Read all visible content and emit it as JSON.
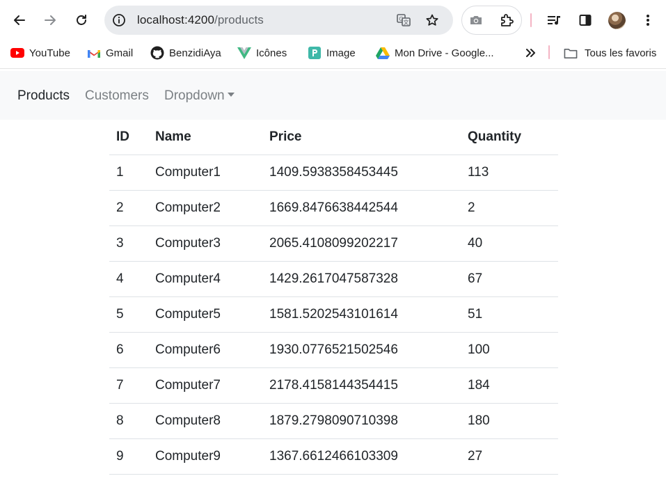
{
  "browser": {
    "url_host": "localhost:4200",
    "url_path": "/products",
    "icons": [
      "back-arrow-icon",
      "forward-arrow-icon",
      "reload-icon",
      "site-info-icon",
      "translate-icon",
      "star-icon",
      "camera-icon",
      "puzzle-extension-icon",
      "media-playlist-icon",
      "side-panel-icon",
      "profile-avatar",
      "kebab-menu-icon"
    ]
  },
  "bookmarks": {
    "items": [
      {
        "label": "YouTube",
        "icon": "youtube-icon",
        "color": "#ff0000"
      },
      {
        "label": "Gmail",
        "icon": "gmail-icon",
        "color": "#ea4335"
      },
      {
        "label": "BenzidiAya",
        "icon": "github-icon",
        "color": "#1f1f1f"
      },
      {
        "label": "Icônes",
        "icon": "vue-icon",
        "color": "#41b883"
      },
      {
        "label": "Image",
        "icon": "image-app-icon",
        "color": "#3fb8a8"
      },
      {
        "label": "Mon Drive - Google...",
        "icon": "google-drive-icon",
        "color": "#1fa463"
      }
    ],
    "more_icon": "double-chevron-icon",
    "all_favorites": {
      "label": "Tous les favoris",
      "icon": "folder-icon"
    }
  },
  "navbar": {
    "links": [
      {
        "label": "Products",
        "active": true
      },
      {
        "label": "Customers",
        "active": false
      },
      {
        "label": "Dropdown",
        "active": false,
        "has_caret": true
      }
    ]
  },
  "table": {
    "headers": [
      "ID",
      "Name",
      "Price",
      "Quantity"
    ],
    "rows": [
      [
        "1",
        "Computer1",
        "1409.5938358453445",
        "113"
      ],
      [
        "2",
        "Computer2",
        "1669.8476638442544",
        "2"
      ],
      [
        "3",
        "Computer3",
        "2065.4108099202217",
        "40"
      ],
      [
        "4",
        "Computer4",
        "1429.2617047587328",
        "67"
      ],
      [
        "5",
        "Computer5",
        "1581.5202543101614",
        "51"
      ],
      [
        "6",
        "Computer6",
        "1930.0776521502546",
        "100"
      ],
      [
        "7",
        "Computer7",
        "2178.4158144354415",
        "184"
      ],
      [
        "8",
        "Computer8",
        "1879.2798090710398",
        "180"
      ],
      [
        "9",
        "Computer9",
        "1367.6612466103309",
        "27"
      ]
    ]
  }
}
